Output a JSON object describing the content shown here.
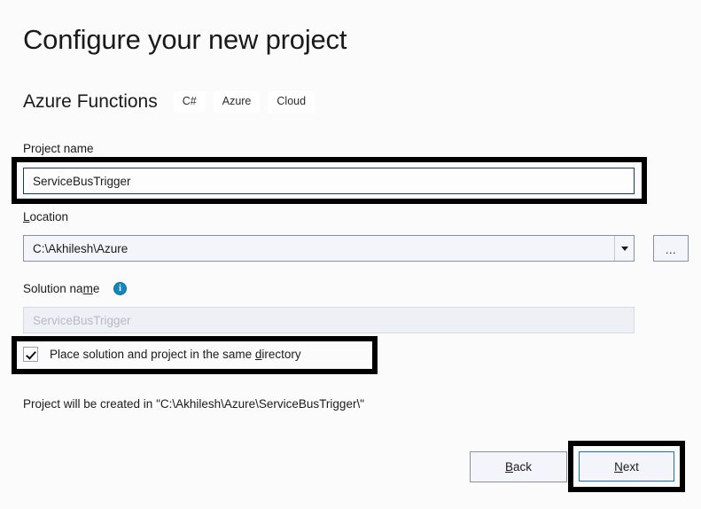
{
  "header": {
    "title": "Configure your new project",
    "subtitle": "Azure Functions",
    "tags": [
      "C#",
      "Azure",
      "Cloud"
    ]
  },
  "fields": {
    "project_name": {
      "label": "Project name",
      "value": "ServiceBusTrigger"
    },
    "location": {
      "label_prefix": "",
      "label_accesskey": "L",
      "label_suffix": "ocation",
      "value": "C:\\Akhilesh\\Azure",
      "dropdown_icon": "chevron-down-icon",
      "browse_label": "..."
    },
    "solution_name": {
      "label_prefix": "Solution na",
      "label_accesskey": "m",
      "label_suffix": "e",
      "value": "ServiceBusTrigger",
      "disabled": "true",
      "info_icon": "info-icon",
      "info_glyph": "i"
    },
    "same_directory": {
      "label_prefix": "Place solution and project in the same ",
      "label_accesskey": "d",
      "label_suffix": "irectory",
      "checked": "true"
    }
  },
  "status": {
    "text": "Project will be created in \"C:\\Akhilesh\\Azure\\ServiceBusTrigger\\\""
  },
  "footer": {
    "back": {
      "prefix": "",
      "accesskey": "B",
      "suffix": "ack"
    },
    "next": {
      "prefix": "",
      "accesskey": "N",
      "suffix": "ext"
    }
  },
  "annotations": {
    "project_name_box": "highlight-rectangle",
    "checkbox_box": "highlight-rectangle",
    "next_box": "highlight-rectangle",
    "color": "#000000"
  },
  "colors": {
    "page_background": "#fbfbfb",
    "focus_border": "#16376b",
    "control_border": "#8a90a4",
    "control_fill": "#f3f5fb",
    "accent": "#1573bb",
    "info_blue": "#1487ba",
    "disabled_fill": "#eef0f6",
    "disabled_text": "#b6bac4"
  }
}
